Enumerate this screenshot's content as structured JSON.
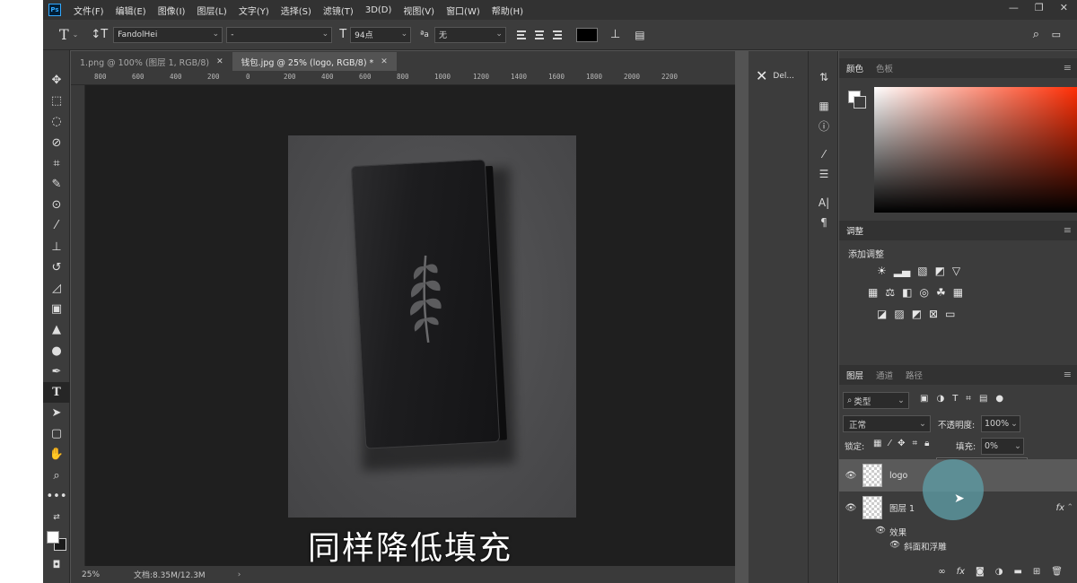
{
  "app": {
    "logo": "Ps",
    "menu": [
      "文件(F)",
      "编辑(E)",
      "图像(I)",
      "图层(L)",
      "文字(Y)",
      "选择(S)",
      "滤镜(T)",
      "3D(D)",
      "视图(V)",
      "窗口(W)",
      "帮助(H)"
    ]
  },
  "options": {
    "font_family": "FandolHei",
    "font_style": "-",
    "font_size": "94点",
    "aa_label": "ªa",
    "antialias": "无",
    "text_color": "#000000"
  },
  "document": {
    "tabs": [
      {
        "label": "1.png @ 100% (图层 1, RGB/8)",
        "active": false
      },
      {
        "label": "钱包.jpg @ 25% (logo, RGB/8) *",
        "active": true
      }
    ],
    "ruler_marks": [
      "800",
      "600",
      "400",
      "200",
      "0",
      "200",
      "400",
      "600",
      "800",
      "1000",
      "1200",
      "1400",
      "1600",
      "1800",
      "2000",
      "2200"
    ],
    "zoom": "25%",
    "doc_info": "文档:8.35M/12.3M",
    "subtitle": "同样降低填充"
  },
  "history": {
    "label": "Del..."
  },
  "color_panel": {
    "tabs": [
      "颜色",
      "色板"
    ]
  },
  "adjust_panel": {
    "tab": "调整",
    "add_label": "添加调整"
  },
  "layers_panel": {
    "tabs": [
      "图层",
      "通道",
      "路径"
    ],
    "filter_type": "类型",
    "blend_mode": "正常",
    "opacity_label": "不透明度:",
    "opacity_value": "100%",
    "lock_label": "锁定:",
    "fill_label": "填充:",
    "fill_value": "0%",
    "layers": [
      {
        "name": "logo",
        "selected": true
      },
      {
        "name": "图层 1",
        "selected": false,
        "fx": "fx"
      }
    ],
    "effects_label": "效果",
    "effect_item": "斜面和浮雕"
  }
}
